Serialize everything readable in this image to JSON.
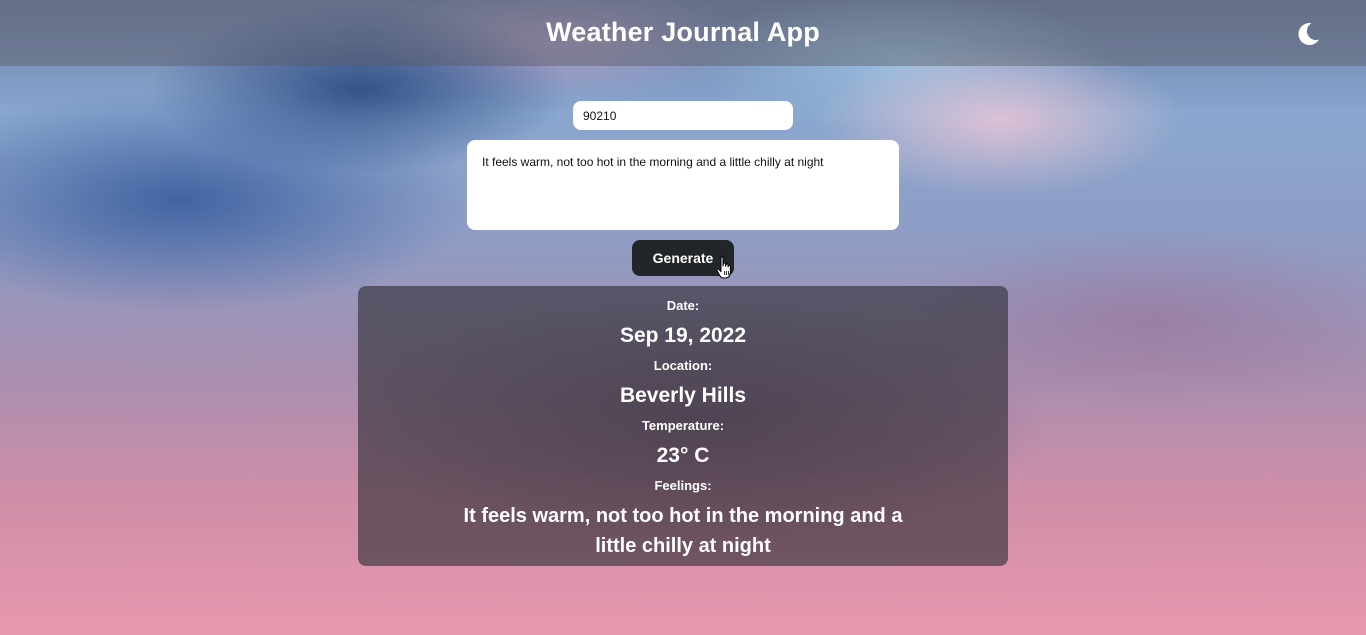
{
  "header": {
    "title": "Weather Journal App",
    "theme_toggle_icon": "moon-icon"
  },
  "form": {
    "zip_value": "90210",
    "feelings_value": "It feels warm, not too hot in the morning and a little chilly at night",
    "generate_label": "Generate"
  },
  "entry": {
    "date_label": "Date:",
    "date_value": "Sep 19, 2022",
    "location_label": "Location:",
    "location_value": "Beverly Hills",
    "temperature_label": "Temperature:",
    "temperature_value": "23° C",
    "feelings_label": "Feelings:",
    "feelings_value": "It feels warm, not too hot in the morning and a little chilly at night"
  },
  "colors": {
    "header_bg": "#5a5a64",
    "button_bg": "#232629",
    "panel_bg": "#2d2d34",
    "text_light": "#ffffff"
  }
}
